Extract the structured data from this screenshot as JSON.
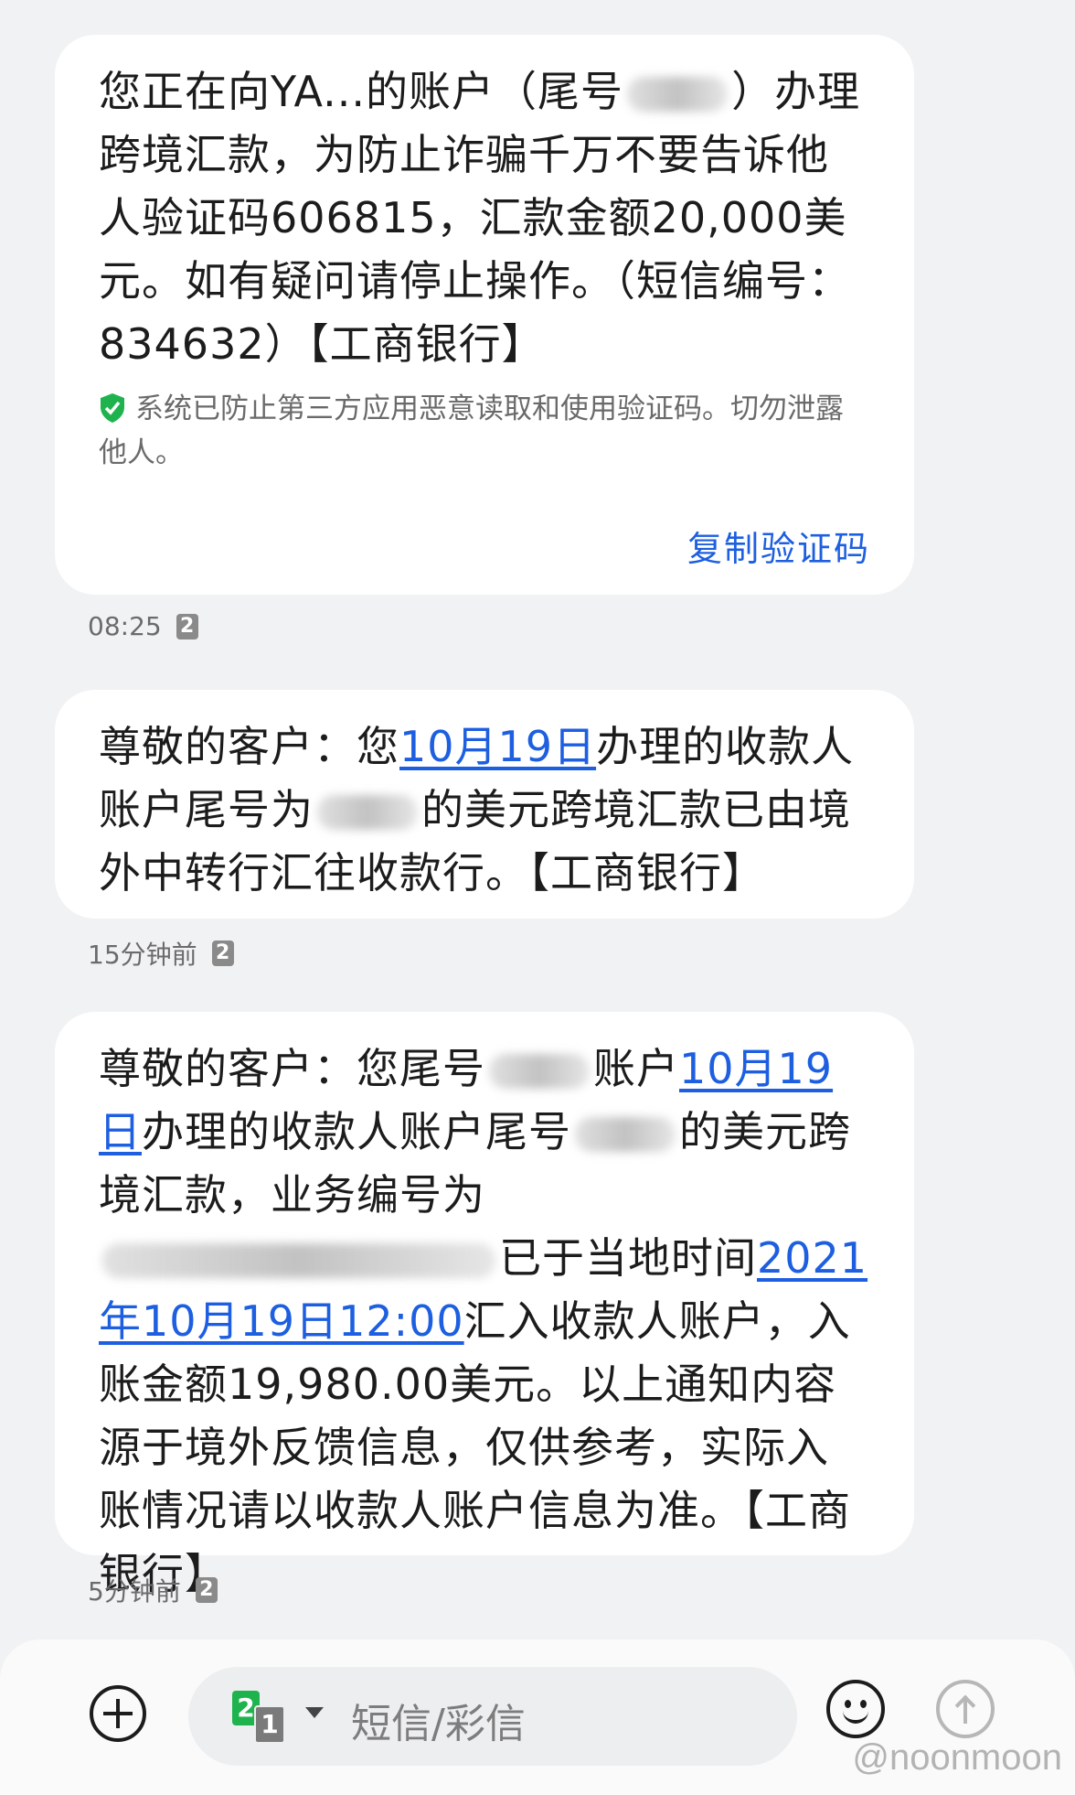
{
  "messages": [
    {
      "id": "msg1",
      "part1": "您正在向YA...的账户（尾号",
      "part2": "）办理跨境汇款，为防止诈骗千万不要告诉他人验证码606815，汇款金额20,000美元。如有疑问请停止操作。（短信编号：834632）【工商银行】",
      "security_notice": "系统已防止第三方应用恶意读取和使用验证码。切勿泄露他人。",
      "copy_code_label": "复制验证码",
      "time": "08:25",
      "sim": "2"
    },
    {
      "id": "msg2",
      "part1": "尊敬的客户：您",
      "date_link": "10月19日",
      "part2": "办理的收款人账户尾号为",
      "part3": "的美元跨境汇款已由境外中转行汇往收款行。【工商银行】",
      "time": "15分钟前",
      "sim": "2"
    },
    {
      "id": "msg3",
      "part1": "尊敬的客户：您尾号",
      "part2": "账户",
      "date_link": "10月19日",
      "part3": "办理的收款人账户尾号",
      "part4": "的美元跨境汇款，业务编号为",
      "part5": "已于当地时间",
      "datetime_link": "2021年10月19日12:00",
      "part6": "汇入收款人账户，入账金额19,980.00美元。以上通知内容源于境外反馈信息，仅供参考，实际入账情况请以收款人账户信息为准。【工商银行】",
      "time": "5分钟前",
      "sim": "2"
    }
  ],
  "composer": {
    "placeholder": "短信/彩信",
    "sim_primary": "2",
    "sim_secondary": "1"
  },
  "watermark": "@noonmoon",
  "colors": {
    "link": "#1d5fe0",
    "security_shield": "#1fb34e",
    "background": "#f1f2f4"
  }
}
